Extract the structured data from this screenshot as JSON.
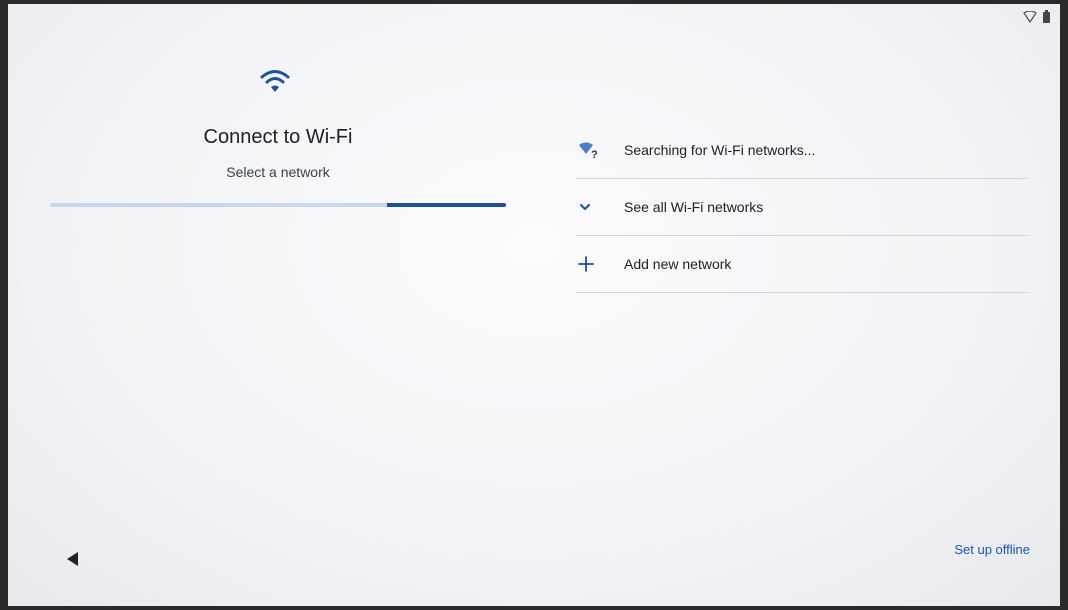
{
  "setup": {
    "title": "Connect to Wi-Fi",
    "subtitle": "Select a network"
  },
  "progress": {
    "fraction_start": 0.74,
    "fraction_end": 1.0
  },
  "networks": {
    "items": [
      {
        "label": "Searching for Wi-Fi networks...",
        "icon": "wifi-searching-icon"
      },
      {
        "label": "See all Wi-Fi networks",
        "icon": "chevron-down-icon"
      },
      {
        "label": "Add new network",
        "icon": "plus-icon"
      }
    ]
  },
  "footer": {
    "offline_label": "Set up offline",
    "back_icon": "back-arrow-icon"
  },
  "status": {
    "icons": [
      "wifi-outline-icon",
      "battery-icon"
    ]
  },
  "colors": {
    "accent": "#1d4fa3",
    "link": "#1a56b0",
    "divider": "#d4d6da"
  }
}
